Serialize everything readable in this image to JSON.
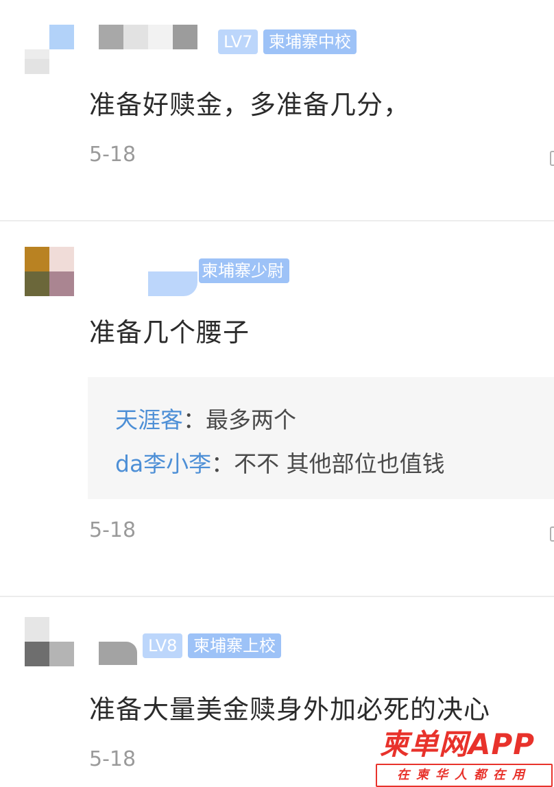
{
  "comments": [
    {
      "level": "LV7",
      "rank": "柬埔寨中校",
      "text": "准备好赎金，多准备几分，",
      "date": "5-18"
    },
    {
      "rank": "柬埔寨少尉",
      "text": "准备几个腰子",
      "replies": [
        {
          "user": "天涯客",
          "sep": "：",
          "message": "最多两个"
        },
        {
          "user": "da李小李",
          "sep": "：",
          "message": "不不 其他部位也值钱"
        }
      ],
      "date": "5-18"
    },
    {
      "level": "LV8",
      "rank": "柬埔寨上校",
      "text": "准备大量美金赎身外加必死的决心",
      "date": "5-18"
    }
  ],
  "watermark": {
    "title": "柬单网APP",
    "subtitle": "在柬华人都在用"
  },
  "colors": {
    "badge_level": "#bcd6fb",
    "badge_rank": "#9dc2f7",
    "reply_user": "#4d8fd6",
    "watermark": "#e8322b"
  }
}
